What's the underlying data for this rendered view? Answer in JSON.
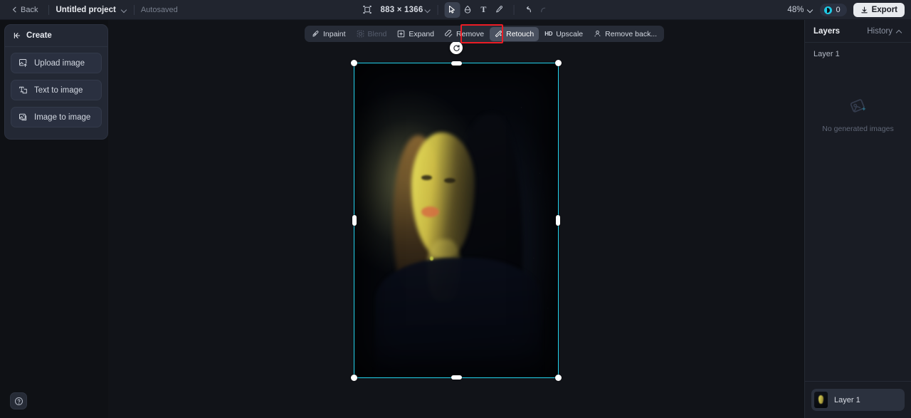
{
  "topbar": {
    "back_label": "Back",
    "project_name": "Untitled project",
    "autosaved_label": "Autosaved",
    "canvas_size": "883 × 1366",
    "zoom_level": "48%",
    "credits_count": "0",
    "export_label": "Export",
    "tools": [
      {
        "name": "select-tool",
        "icon": "cursor-icon",
        "active": true
      },
      {
        "name": "eraser-tool",
        "icon": "eraser-icon",
        "active": false
      },
      {
        "name": "text-tool",
        "icon": "text-icon",
        "label": "T",
        "active": false
      },
      {
        "name": "brush-tool",
        "icon": "brush-icon",
        "active": false
      }
    ],
    "undo_label": "Undo",
    "redo_label": "Redo",
    "resize_icon": "resize-canvas-icon"
  },
  "create_panel": {
    "title": "Create",
    "collapse_icon": "collapse-panel-icon",
    "buttons": [
      {
        "label": "Upload image",
        "icon": "upload-image-icon"
      },
      {
        "label": "Text to image",
        "icon": "text-to-image-icon"
      },
      {
        "label": "Image to image",
        "icon": "image-to-image-icon"
      }
    ]
  },
  "context_toolbar": {
    "items": [
      {
        "label": "Inpaint",
        "icon": "inpaint-icon",
        "state": "normal"
      },
      {
        "label": "Blend",
        "icon": "blend-icon",
        "state": "disabled"
      },
      {
        "label": "Expand",
        "icon": "expand-icon",
        "state": "normal"
      },
      {
        "label": "Remove",
        "icon": "remove-icon",
        "state": "normal"
      },
      {
        "label": "Retouch",
        "icon": "retouch-icon",
        "state": "active"
      },
      {
        "label": "Upscale",
        "icon": "hd-icon",
        "state": "normal"
      },
      {
        "label": "Remove back...",
        "icon": "remove-background-icon",
        "state": "normal"
      }
    ],
    "highlight_color": "#ec1c24",
    "highlighted_item": "Retouch"
  },
  "right_panel": {
    "layers_tab": "Layers",
    "history_tab": "History",
    "active_layer_label": "Layer 1",
    "empty_state_text": "No generated images",
    "empty_state_icon": "image-placeholder-icon",
    "layers": [
      {
        "name": "Layer 1"
      }
    ]
  },
  "canvas": {
    "selection_color": "#22d3ee",
    "rotate_handle_icon": "rotate-icon"
  },
  "help": {
    "icon": "help-question-icon",
    "label": "Help"
  }
}
